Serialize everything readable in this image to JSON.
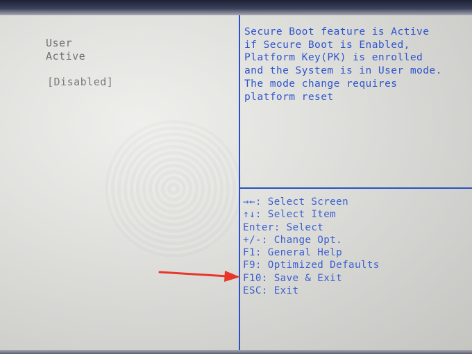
{
  "settings": {
    "values": [
      "User",
      "Active",
      "[Disabled]"
    ]
  },
  "help_panel": {
    "lines": [
      "Secure Boot feature is Active",
      "if Secure Boot is Enabled,",
      "Platform Key(PK) is enrolled",
      "and the System is in User mode.",
      "The mode change requires",
      "platform reset"
    ]
  },
  "key_legend": {
    "items": [
      "→←: Select Screen",
      "↑↓: Select Item",
      "Enter: Select",
      "+/-: Change Opt.",
      "F1: General Help",
      "F9: Optimized Defaults",
      "F10: Save & Exit",
      "ESC: Exit"
    ]
  },
  "colors": {
    "help_text": "#2f55cc",
    "divider": "#2b4fc4",
    "value_text": "#6f6f6f",
    "annotation_arrow": "#e8362a"
  },
  "icons": {
    "annotation": "red-arrow-icon"
  }
}
